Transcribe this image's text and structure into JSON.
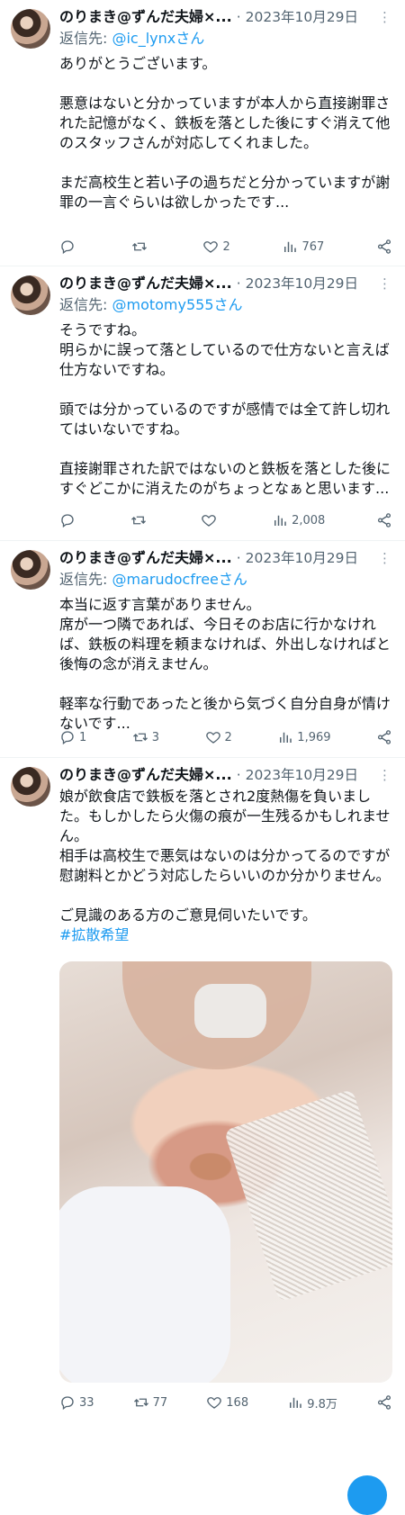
{
  "tweets": [
    {
      "name": "のりまき@ずんだ夫婦×...",
      "date": "2023年10月29日",
      "reply_prefix": "返信先: ",
      "reply_handle": "@ic_lynxさん",
      "text": "ありがとうございます。\n\n悪意はないと分かっていますが本人から直接謝罪された記憶がなく、鉄板を落とした後にすぐ消えて他のスタッフさんが対応してくれました。\n\nまだ高校生と若い子の過ちだと分かっていますが謝罪の一言ぐらいは欲しかったです...",
      "replies": "",
      "retweets": "",
      "likes": "2",
      "views": "767"
    },
    {
      "name": "のりまき@ずんだ夫婦×...",
      "date": "2023年10月29日",
      "reply_prefix": "返信先: ",
      "reply_handle": "@motomy555さん",
      "text": "そうですね。\n明らかに誤って落としているので仕方ないと言えば仕方ないですね。\n\n頭では分かっているのですが感情では全て許し切れてはいないですね。\n\n直接謝罪された訳ではないのと鉄板を落とした後にすぐどこかに消えたのがちょっとなぁと思います...",
      "replies": "",
      "retweets": "",
      "likes": "",
      "views": "2,008"
    },
    {
      "name": "のりまき@ずんだ夫婦×...",
      "date": "2023年10月29日",
      "reply_prefix": "返信先: ",
      "reply_handle": "@marudocfreeさん",
      "text": "本当に返す言葉がありません。\n席が一つ隣であれば、今日そのお店に行かなければ、鉄板の料理を頼まなければ、外出しなければと後悔の念が消えません。\n\n軽率な行動であったと後から気づく自分自身が情けないです...",
      "replies": "1",
      "retweets": "3",
      "likes": "2",
      "views": "1,969"
    },
    {
      "name": "のりまき@ずんだ夫婦×...",
      "date": "2023年10月29日",
      "text": "娘が飲食店で鉄板を落とされ2度熱傷を負いました。もしかしたら火傷の痕が一生残るかもしれません。\n相手は高校生で悪気はないのは分かってるのですが慰謝料とかどう対応したらいいのか分かりません。\n\nご見識のある方のご意見伺いたいです。",
      "hashtag": "#拡散希望",
      "replies": "33",
      "retweets": "77",
      "likes": "168",
      "views": "9.8万"
    }
  ],
  "icons": {
    "more": "more-dots-icon",
    "reply": "reply-bubble-icon",
    "retweet": "retweet-icon",
    "like": "heart-icon",
    "views": "views-bar-chart-icon",
    "share": "share-icon"
  },
  "colors": {
    "link": "#1d9bf0",
    "muted": "#536471",
    "divider": "#eff3f4"
  }
}
